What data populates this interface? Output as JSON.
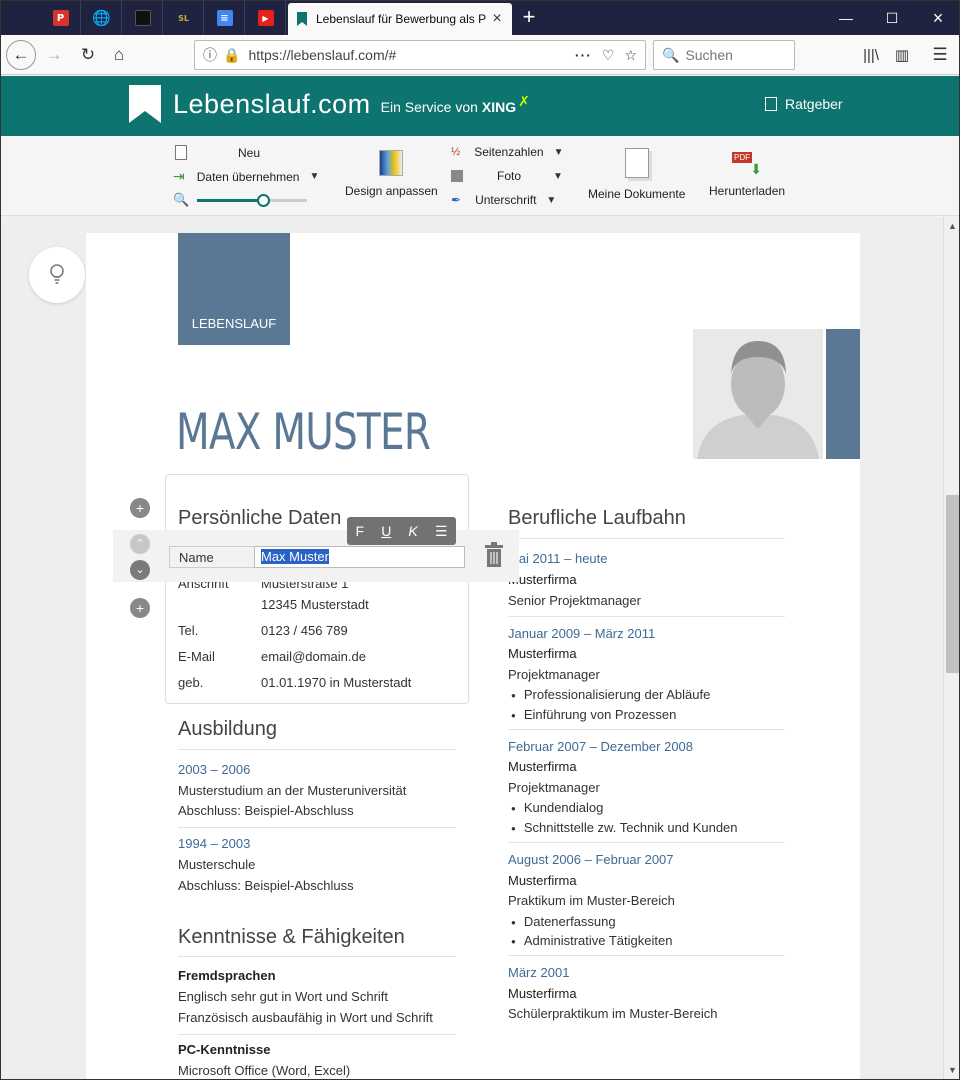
{
  "browser": {
    "active_tab_title": "Lebenslauf für Bewerbung als P",
    "url": "https://lebenslauf.com/#",
    "search_placeholder": "Suchen",
    "tab_favicons": [
      {
        "icon": "pdf-red-icon",
        "color": "#d9342b",
        "glyph": "P"
      },
      {
        "icon": "globe-icon",
        "color": "#ffffff",
        "glyph": "🌐"
      },
      {
        "icon": "app-dark-icon",
        "color": "#111111",
        "glyph": "■"
      },
      {
        "icon": "sl-icon",
        "color": "#c8a93c",
        "glyph": "SL"
      },
      {
        "icon": "docs-icon",
        "color": "#4285f4",
        "glyph": "≡"
      },
      {
        "icon": "youtube-audio-icon",
        "color": "#e62117",
        "glyph": "▶"
      }
    ]
  },
  "site": {
    "brand": "Lebenslauf.com",
    "service_text": "Ein Service von",
    "service_partner": "XING",
    "ratgeber": "Ratgeber",
    "header_color": "#0e7470"
  },
  "toolbar": {
    "neu": "Neu",
    "daten_uebernehmen": "Daten übernehmen",
    "design_anpassen": "Design anpassen",
    "seitenzahlen": "Seitenzahlen",
    "foto": "Foto",
    "unterschrift": "Unterschrift",
    "meine_dokumente": "Meine Dokumente",
    "herunterladen": "Herunterladen",
    "zoom_level": 0.6,
    "pdf_label": "PDF"
  },
  "cv": {
    "label": "LEBENSLAUF",
    "name": "MAX MUSTER",
    "accent_color": "#5a7894",
    "personal": {
      "heading": "Persönliche Daten",
      "name_label": "Name",
      "name_value": "Max Muster",
      "rows": [
        {
          "label": "Anschrift",
          "value": "Musterstraße 1"
        },
        {
          "label": "",
          "value": "12345 Musterstadt"
        },
        {
          "label": "Tel.",
          "value": "0123 / 456 789"
        },
        {
          "label": "E-Mail",
          "value": "email@domain.de"
        },
        {
          "label": "geb.",
          "value": "01.01.1970 in Musterstadt"
        }
      ]
    },
    "education": {
      "heading": "Ausbildung",
      "entries": [
        {
          "period": "2003 – 2006",
          "line1": "Musterstudium an der Musteruniversität",
          "line2": "Abschluss: Beispiel-Abschluss"
        },
        {
          "period": "1994 – 2003",
          "line1": "Musterschule",
          "line2": "Abschluss: Beispiel-Abschluss"
        }
      ]
    },
    "skills": {
      "heading": "Kenntnisse & Fähigkeiten",
      "groups": [
        {
          "title": "Fremdsprachen",
          "items": [
            "Englisch sehr gut in Wort und Schrift",
            "Französisch ausbaufähig in Wort und Schrift"
          ]
        },
        {
          "title": "PC-Kenntnisse",
          "items": [
            "Microsoft Office (Word, Excel)"
          ]
        }
      ]
    },
    "career": {
      "heading": "Berufliche Laufbahn",
      "entries": [
        {
          "period": "Mai 2011 – heute",
          "company": "Musterfirma",
          "role": "Senior Projektmanager",
          "bullets": []
        },
        {
          "period": "Januar 2009 – März 2011",
          "company": "Musterfirma",
          "role": "Projektmanager",
          "bullets": [
            "Professionalisierung der Abläufe",
            "Einführung von Prozessen"
          ]
        },
        {
          "period": "Februar 2007 – Dezember 2008",
          "company": "Musterfirma",
          "role": "Projektmanager",
          "bullets": [
            "Kundendialog",
            "Schnittstelle zw. Technik und Kunden"
          ]
        },
        {
          "period": "August 2006 – Februar 2007",
          "company": "Musterfirma",
          "role": "Praktikum im Muster-Bereich",
          "bullets": [
            "Datenerfassung",
            "Administrative Tätigkeiten"
          ]
        },
        {
          "period": "März 2001",
          "company": "Musterfirma",
          "role": "Schülerpraktikum im Muster-Bereich",
          "bullets": []
        }
      ]
    }
  },
  "format_bar": {
    "bold": "F",
    "underline": "U",
    "italic": "K"
  }
}
